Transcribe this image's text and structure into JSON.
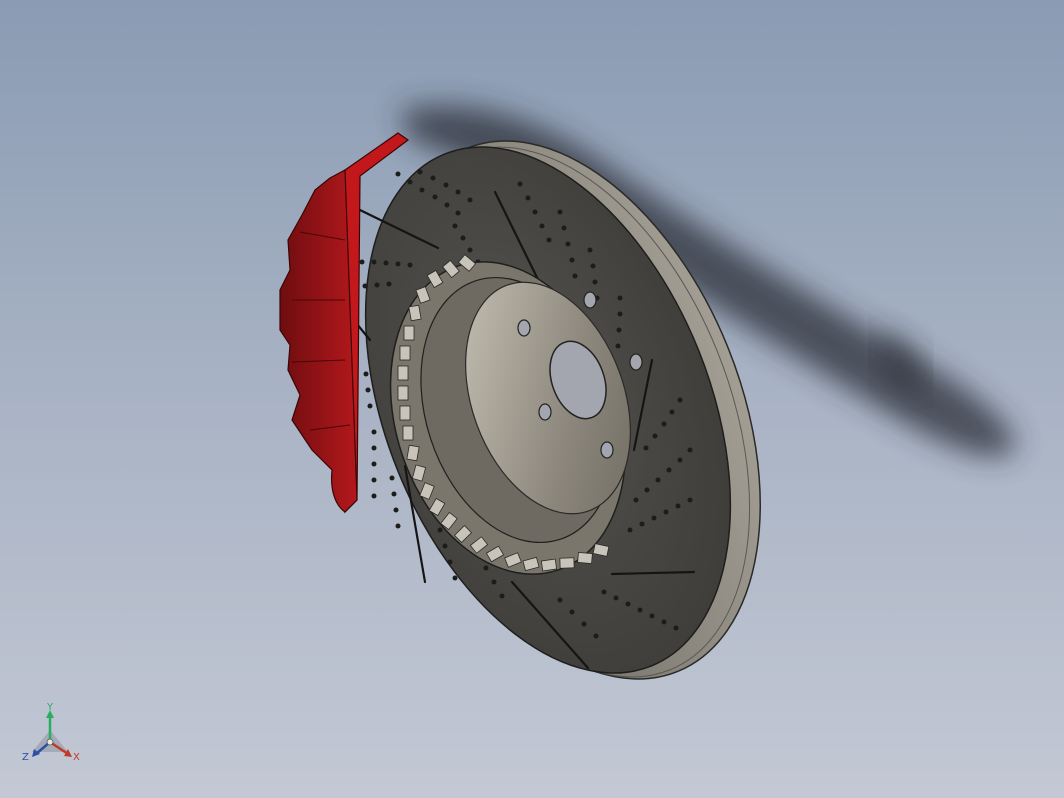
{
  "viewport": {
    "background_top": "#8a9bb3",
    "background_bottom": "#c3c8d4"
  },
  "model": {
    "rotor_color": "#4a4945",
    "rotor_edge_color": "#8d8a80",
    "caliper_color": "#a81418",
    "hat_color": "#8c877c",
    "shadow_color": "#2b2f38"
  },
  "triad": {
    "x_label": "X",
    "y_label": "Y",
    "z_label": "Z",
    "x_color": "#c0392b",
    "y_color": "#27ae60",
    "z_color": "#2e4fa8"
  }
}
